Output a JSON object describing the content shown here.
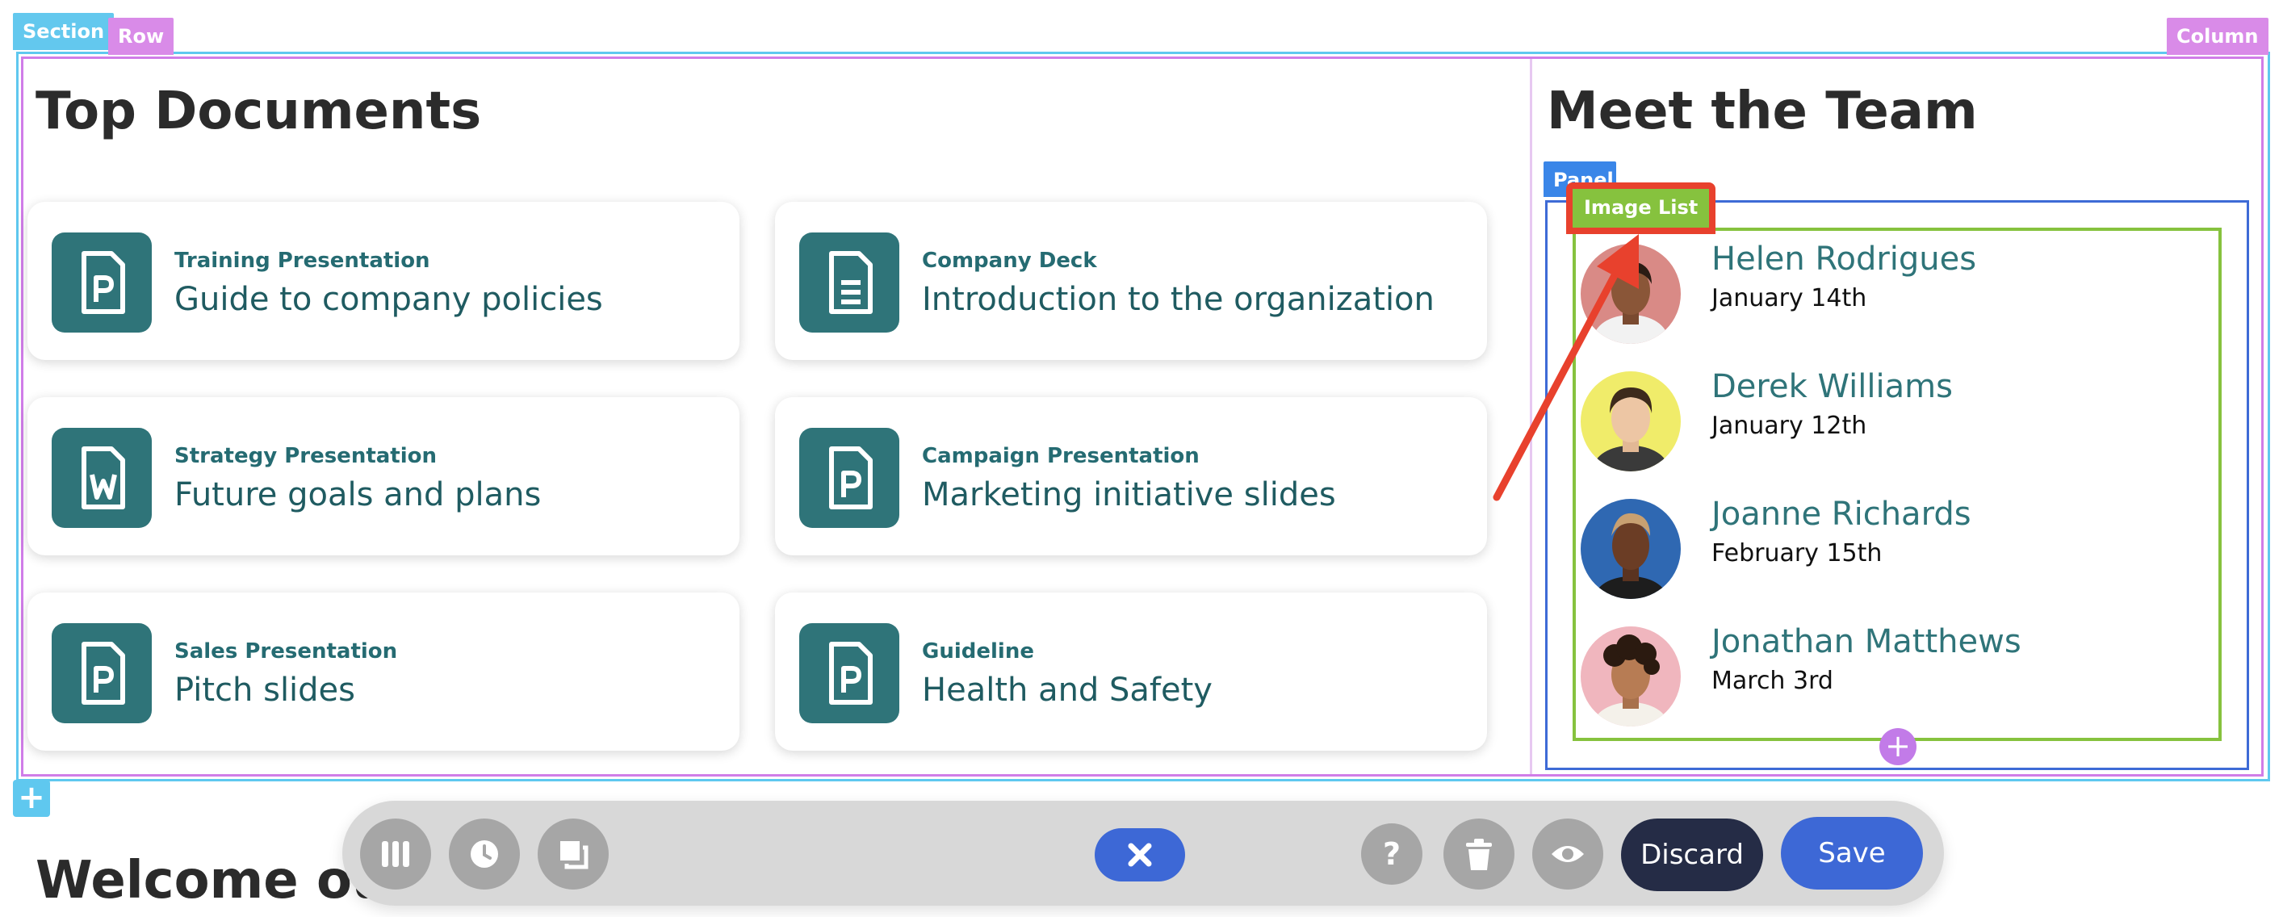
{
  "editor_tags": {
    "section": "Section",
    "row": "Row",
    "column": "Column",
    "panel": "Panel",
    "image_list": "Image List"
  },
  "documents": {
    "title": "Top Documents",
    "cards": [
      {
        "kicker": "Training Presentation",
        "title": "Guide to company policies",
        "icon": "powerpoint-file-icon"
      },
      {
        "kicker": "Company Deck",
        "title": "Introduction to the organization",
        "icon": "document-file-icon"
      },
      {
        "kicker": "Strategy Presentation",
        "title": "Future goals and plans",
        "icon": "word-file-icon"
      },
      {
        "kicker": "Campaign Presentation",
        "title": "Marketing initiative slides",
        "icon": "powerpoint-file-icon"
      },
      {
        "kicker": "Sales Presentation",
        "title": "Pitch slides",
        "icon": "powerpoint-file-icon"
      },
      {
        "kicker": "Guideline",
        "title": "Health and Safety",
        "icon": "powerpoint-file-icon"
      }
    ]
  },
  "team": {
    "title": "Meet the Team",
    "people": [
      {
        "name": "Helen Rodrigues",
        "date": "January 14th"
      },
      {
        "name": "Derek Williams",
        "date": "January 12th"
      },
      {
        "name": "Joanne Richards",
        "date": "February 15th"
      },
      {
        "name": "Jonathan Matthews",
        "date": "March 3rd"
      }
    ]
  },
  "next_section": {
    "heading": "Welcome our n"
  },
  "toolbar": {
    "discard_label": "Discard",
    "save_label": "Save",
    "help_label": "?"
  },
  "add_symbol": "+",
  "colors": {
    "teal": "#2f7479",
    "section_outline": "#5fc8ef",
    "row_outline": "#d07de8",
    "panel_outline": "#3e6bd6",
    "image_list_outline": "#86c23e",
    "highlight_red": "#e8412d",
    "save_blue": "#3d68d6",
    "discard_navy": "#252c46"
  }
}
